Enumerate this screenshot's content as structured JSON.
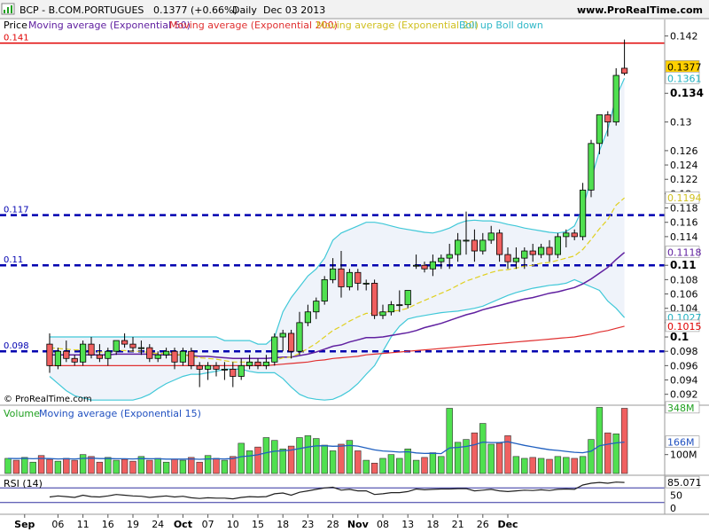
{
  "header": {
    "symbol": "BCP - B.COM.PORTUGUES",
    "last": "0.1377 (+0.66%)",
    "period": "Daily",
    "date": "Dec 03 2013",
    "site": "www.ProRealTime.com"
  },
  "legend": {
    "price": "Price",
    "ema50": "Moving average (Exponential 50)",
    "ema200": "Moving average (Exponential 200)",
    "ema20": "Moving average (Exponential 20)",
    "boll": "Boll up Boll down"
  },
  "watermark": "© ProRealTime.com",
  "volume_legend": {
    "title": "Volume",
    "ma": "Moving average (Exponential 15)"
  },
  "rsi_legend": "RSI (14)",
  "levels": [
    {
      "value": 0.141,
      "label": "0.141",
      "color": "#e00000",
      "style": "solid"
    },
    {
      "value": 0.117,
      "label": "0.117",
      "color": "#0000b0",
      "style": "dashed"
    },
    {
      "value": 0.11,
      "label": "0.11",
      "color": "#0000b0",
      "style": "dashed"
    },
    {
      "value": 0.098,
      "label": "0.098",
      "color": "#0000b0",
      "style": "dashed"
    }
  ],
  "price_badges": [
    {
      "value": 0.1377,
      "label": "0.1377",
      "bg": "#ffd000",
      "fg": "#000000"
    },
    {
      "value": 0.1361,
      "label": "0.1361",
      "bg": "#ffffff",
      "fg": "#20b0c0"
    },
    {
      "value": 0.1194,
      "label": "0.1194",
      "bg": "#ffffff",
      "fg": "#d0c020"
    },
    {
      "value": 0.1118,
      "label": "0.1118",
      "bg": "#ffffff",
      "fg": "#6020a0"
    },
    {
      "value": 0.1027,
      "label": "0.1027",
      "bg": "#ffffff",
      "fg": "#20b0c0"
    },
    {
      "value": 0.1015,
      "label": "0.1015",
      "bg": "#ffffff",
      "fg": "#e00000"
    }
  ],
  "volume_badges": [
    {
      "value": 348,
      "label": "348M",
      "bg": "#ffffff",
      "fg": "#20a020"
    },
    {
      "value": 166,
      "label": "166M",
      "bg": "#ffffff",
      "fg": "#2050c0"
    }
  ],
  "rsi_badge": {
    "label": "85.071"
  },
  "colors": {
    "up": "#50e050",
    "down": "#f06060",
    "bb": "#40c8d8",
    "ema20": "#e0d020",
    "ema50": "#6020a0",
    "ema200": "#e03030",
    "vol_ma": "#2060c0",
    "rsi": "#202020",
    "level": "#0000b0"
  },
  "chart_data": {
    "type": "candlestick",
    "price_axis": {
      "ticks": [
        0.142,
        0.134,
        0.13,
        0.126,
        0.124,
        0.122,
        0.12,
        0.118,
        0.116,
        0.114,
        0.11,
        0.108,
        0.106,
        0.104,
        0.102,
        0.1,
        0.098,
        0.096,
        0.094,
        0.092
      ],
      "bold": [
        0.134,
        0.11,
        0.1
      ],
      "range": [
        0.0906,
        0.1443
      ]
    },
    "volume_axis": {
      "ticks": [
        {
          "value": 100,
          "label": "100M"
        }
      ],
      "range": [
        0,
        352
      ]
    },
    "rsi_axis": {
      "ticks": [
        50,
        0
      ],
      "range": [
        0,
        100
      ],
      "lines": [
        70,
        30
      ]
    },
    "x_labels": [
      "Sep",
      "06",
      "11",
      "16",
      "19",
      "24",
      "Oct",
      "07",
      "10",
      "15",
      "18",
      "23",
      "28",
      "Nov",
      "08",
      "13",
      "18",
      "21",
      "26",
      "Dec"
    ],
    "x_label_index": [
      2,
      6,
      9,
      12,
      15,
      18,
      21,
      24,
      27,
      30,
      33,
      36,
      39,
      42,
      45,
      48,
      51,
      54,
      57,
      60
    ],
    "candles": [
      [
        0.099,
        0.1005,
        0.095,
        0.096
      ],
      [
        0.096,
        0.0985,
        0.0955,
        0.098
      ],
      [
        0.098,
        0.0995,
        0.0965,
        0.097
      ],
      [
        0.097,
        0.0975,
        0.096,
        0.0965
      ],
      [
        0.0965,
        0.0995,
        0.096,
        0.099
      ],
      [
        0.099,
        0.1,
        0.097,
        0.0975
      ],
      [
        0.0975,
        0.099,
        0.0965,
        0.097
      ],
      [
        0.097,
        0.0985,
        0.096,
        0.098
      ],
      [
        0.098,
        0.0995,
        0.0975,
        0.0995
      ],
      [
        0.0995,
        0.1005,
        0.0985,
        0.099
      ],
      [
        0.099,
        0.1,
        0.098,
        0.0985
      ],
      [
        0.0985,
        0.0995,
        0.0975,
        0.0985
      ],
      [
        0.0985,
        0.099,
        0.0965,
        0.097
      ],
      [
        0.097,
        0.098,
        0.0965,
        0.0975
      ],
      [
        0.0975,
        0.0985,
        0.097,
        0.098
      ],
      [
        0.098,
        0.0985,
        0.0955,
        0.0965
      ],
      [
        0.0965,
        0.0985,
        0.096,
        0.098
      ],
      [
        0.098,
        0.0985,
        0.0955,
        0.096
      ],
      [
        0.096,
        0.0965,
        0.093,
        0.0955
      ],
      [
        0.0955,
        0.0965,
        0.094,
        0.096
      ],
      [
        0.096,
        0.0965,
        0.0945,
        0.0955
      ],
      [
        0.0955,
        0.0965,
        0.094,
        0.0955
      ],
      [
        0.0955,
        0.0965,
        0.093,
        0.0945
      ],
      [
        0.0945,
        0.097,
        0.094,
        0.096
      ],
      [
        0.096,
        0.0975,
        0.0955,
        0.0965
      ],
      [
        0.0965,
        0.097,
        0.0955,
        0.096
      ],
      [
        0.096,
        0.0975,
        0.0955,
        0.0965
      ],
      [
        0.0965,
        0.1005,
        0.096,
        0.1
      ],
      [
        0.1,
        0.101,
        0.098,
        0.1005
      ],
      [
        0.1005,
        0.101,
        0.097,
        0.098
      ],
      [
        0.098,
        0.1035,
        0.0975,
        0.102
      ],
      [
        0.102,
        0.1045,
        0.1015,
        0.1035
      ],
      [
        0.1035,
        0.1055,
        0.1025,
        0.105
      ],
      [
        0.105,
        0.1085,
        0.1045,
        0.108
      ],
      [
        0.108,
        0.111,
        0.1075,
        0.1095
      ],
      [
        0.1095,
        0.112,
        0.1055,
        0.107
      ],
      [
        0.107,
        0.1095,
        0.1065,
        0.109
      ],
      [
        0.109,
        0.1095,
        0.1065,
        0.1075
      ],
      [
        0.1075,
        0.108,
        0.1065,
        0.1075
      ],
      [
        0.1075,
        0.108,
        0.1025,
        0.103
      ],
      [
        0.103,
        0.1045,
        0.1025,
        0.1035
      ],
      [
        0.1035,
        0.105,
        0.103,
        0.1045
      ],
      [
        0.1045,
        0.1065,
        0.1035,
        0.1045
      ],
      [
        0.1045,
        0.1065,
        0.104,
        0.1065
      ],
      [
        0.11,
        0.1115,
        0.1095,
        0.11
      ],
      [
        0.11,
        0.1105,
        0.109,
        0.1095
      ],
      [
        0.1095,
        0.1115,
        0.1085,
        0.1105
      ],
      [
        0.1105,
        0.1115,
        0.1095,
        0.111
      ],
      [
        0.111,
        0.113,
        0.1095,
        0.1115
      ],
      [
        0.1115,
        0.1145,
        0.1105,
        0.1135
      ],
      [
        0.1135,
        0.1175,
        0.1115,
        0.1135
      ],
      [
        0.1135,
        0.115,
        0.1105,
        0.112
      ],
      [
        0.112,
        0.1145,
        0.1115,
        0.1135
      ],
      [
        0.1135,
        0.1155,
        0.113,
        0.1145
      ],
      [
        0.1145,
        0.115,
        0.1105,
        0.1115
      ],
      [
        0.1115,
        0.1125,
        0.1095,
        0.1105
      ],
      [
        0.1105,
        0.1125,
        0.1095,
        0.111
      ],
      [
        0.111,
        0.1125,
        0.1095,
        0.112
      ],
      [
        0.112,
        0.113,
        0.1105,
        0.1115
      ],
      [
        0.1115,
        0.113,
        0.111,
        0.1125
      ],
      [
        0.1125,
        0.1135,
        0.1105,
        0.1115
      ],
      [
        0.1115,
        0.1145,
        0.111,
        0.114
      ],
      [
        0.114,
        0.115,
        0.1125,
        0.1145
      ],
      [
        0.1145,
        0.115,
        0.1135,
        0.114
      ],
      [
        0.114,
        0.1215,
        0.1135,
        0.1205
      ],
      [
        0.1205,
        0.1275,
        0.1195,
        0.127
      ],
      [
        0.127,
        0.131,
        0.1255,
        0.131
      ],
      [
        0.131,
        0.1315,
        0.128,
        0.13
      ],
      [
        0.13,
        0.1375,
        0.1295,
        0.1365
      ],
      [
        0.1375,
        0.1415,
        0.1365,
        0.1368
      ]
    ],
    "volume": [
      80,
      70,
      85,
      60,
      95,
      75,
      65,
      80,
      70,
      100,
      90,
      60,
      85,
      70,
      75,
      65,
      90,
      70,
      80,
      60,
      75,
      70,
      85,
      60,
      95,
      80,
      70,
      90,
      160,
      120,
      140,
      190,
      175,
      130,
      145,
      190,
      200,
      185,
      150,
      120,
      155,
      175,
      120,
      70,
      55,
      80,
      100,
      80,
      130,
      70,
      85,
      110,
      90,
      345,
      165,
      180,
      215,
      265,
      155,
      160,
      200,
      90,
      80,
      85,
      80,
      75,
      90,
      85,
      80,
      90,
      180,
      350,
      215,
      210,
      345
    ],
    "volume_ma": [
      80,
      79,
      80,
      78,
      80,
      79,
      77,
      78,
      77,
      80,
      81,
      79,
      79,
      78,
      78,
      77,
      79,
      78,
      78,
      76,
      76,
      76,
      77,
      75,
      77,
      78,
      77,
      79,
      89,
      93,
      99,
      110,
      118,
      120,
      124,
      132,
      140,
      146,
      147,
      144,
      145,
      149,
      145,
      135,
      125,
      119,
      117,
      113,
      115,
      109,
      106,
      107,
      105,
      135,
      138,
      143,
      152,
      166,
      164,
      164,
      168,
      158,
      149,
      141,
      133,
      126,
      122,
      117,
      112,
      110,
      118,
      147,
      155,
      162,
      166
    ],
    "rsi": [
      45,
      48,
      46,
      44,
      50,
      46,
      45,
      48,
      52,
      50,
      48,
      47,
      44,
      46,
      48,
      45,
      47,
      43,
      41,
      43,
      42,
      42,
      40,
      44,
      46,
      45,
      46,
      54,
      56,
      50,
      58,
      62,
      66,
      70,
      72,
      64,
      66,
      62,
      62,
      52,
      54,
      57,
      57,
      60,
      67,
      65,
      66,
      67,
      67,
      68,
      68,
      62,
      64,
      66,
      62,
      60,
      62,
      64,
      63,
      65,
      63,
      66,
      67,
      66,
      78,
      83,
      85,
      83,
      86,
      85.1
    ],
    "ema20": [
      0.0985,
      0.0984,
      0.0983,
      0.0982,
      0.0982,
      0.0981,
      0.0979,
      0.0979,
      0.0981,
      0.0981,
      0.098,
      0.098,
      0.0978,
      0.0977,
      0.0977,
      0.0975,
      0.0975,
      0.0973,
      0.0971,
      0.097,
      0.0969,
      0.0967,
      0.0965,
      0.0965,
      0.0965,
      0.0964,
      0.0964,
      0.0967,
      0.0971,
      0.0972,
      0.0977,
      0.0984,
      0.0991,
      0.1,
      0.1009,
      0.1015,
      0.1022,
      0.1028,
      0.1033,
      0.1033,
      0.1034,
      0.1036,
      0.1037,
      0.104,
      0.1046,
      0.1051,
      0.1056,
      0.1061,
      0.1066,
      0.1072,
      0.1078,
      0.1082,
      0.1086,
      0.109,
      0.1093,
      0.1094,
      0.1096,
      0.1099,
      0.11,
      0.1103,
      0.1104,
      0.1107,
      0.111,
      0.1113,
      0.1122,
      0.1136,
      0.1151,
      0.1164,
      0.1184,
      0.1194
    ],
    "ema50": [
      0.0975,
      0.0975,
      0.0975,
      0.0975,
      0.0975,
      0.0975,
      0.0975,
      0.0975,
      0.0976,
      0.0976,
      0.0976,
      0.0976,
      0.0976,
      0.0975,
      0.0975,
      0.0975,
      0.0975,
      0.0974,
      0.0973,
      0.0973,
      0.0972,
      0.0971,
      0.097,
      0.097,
      0.097,
      0.097,
      0.097,
      0.0971,
      0.0972,
      0.0972,
      0.0974,
      0.0976,
      0.0979,
      0.0983,
      0.0987,
      0.0989,
      0.0993,
      0.0996,
      0.0999,
      0.0999,
      0.1,
      0.1002,
      0.1004,
      0.1006,
      0.1009,
      0.1013,
      0.1016,
      0.1019,
      0.1023,
      0.1027,
      0.1031,
      0.1034,
      0.1038,
      0.1041,
      0.1044,
      0.1047,
      0.105,
      0.1053,
      0.1055,
      0.1058,
      0.1061,
      0.1063,
      0.1066,
      0.1069,
      0.1074,
      0.1081,
      0.1089,
      0.1097,
      0.1108,
      0.1118
    ],
    "ema200": [
      0.096,
      0.096,
      0.096,
      0.096,
      0.096,
      0.096,
      0.096,
      0.096,
      0.096,
      0.096,
      0.096,
      0.096,
      0.096,
      0.096,
      0.096,
      0.096,
      0.096,
      0.096,
      0.096,
      0.096,
      0.096,
      0.096,
      0.096,
      0.096,
      0.096,
      0.096,
      0.096,
      0.0961,
      0.0962,
      0.0963,
      0.0964,
      0.0965,
      0.0967,
      0.0968,
      0.097,
      0.0971,
      0.0972,
      0.0973,
      0.0975,
      0.0976,
      0.0977,
      0.0978,
      0.0979,
      0.098,
      0.0981,
      0.0982,
      0.0983,
      0.0984,
      0.0985,
      0.0986,
      0.0987,
      0.0988,
      0.0989,
      0.099,
      0.0991,
      0.0992,
      0.0993,
      0.0994,
      0.0995,
      0.0996,
      0.0997,
      0.0998,
      0.0999,
      0.1,
      0.1002,
      0.1004,
      0.1007,
      0.1009,
      0.1012,
      0.1015
    ],
    "bb_up": [
      0.1,
      0.1,
      0.1,
      0.1,
      0.1,
      0.1,
      0.1,
      0.1,
      0.1,
      0.1,
      0.1,
      0.1,
      0.1,
      0.1,
      0.1,
      0.1,
      0.1,
      0.1,
      0.1,
      0.1,
      0.1,
      0.0995,
      0.0995,
      0.0995,
      0.0995,
      0.099,
      0.099,
      0.1,
      0.1035,
      0.1055,
      0.107,
      0.1085,
      0.1095,
      0.111,
      0.1135,
      0.1145,
      0.115,
      0.1155,
      0.116,
      0.116,
      0.1158,
      0.1155,
      0.1152,
      0.115,
      0.1148,
      0.1146,
      0.1145,
      0.1148,
      0.1152,
      0.1158,
      0.1162,
      0.1163,
      0.1162,
      0.1162,
      0.116,
      0.1157,
      0.1155,
      0.1152,
      0.115,
      0.1148,
      0.1146,
      0.1145,
      0.1147,
      0.1155,
      0.118,
      0.122,
      0.126,
      0.129,
      0.1335,
      0.1361
    ],
    "bb_dn": [
      0.0945,
      0.0935,
      0.0925,
      0.0918,
      0.0915,
      0.0912,
      0.0912,
      0.0912,
      0.0912,
      0.0912,
      0.0912,
      0.0915,
      0.092,
      0.0928,
      0.0935,
      0.094,
      0.0945,
      0.0948,
      0.0948,
      0.095,
      0.0952,
      0.0955,
      0.0955,
      0.0955,
      0.0952,
      0.095,
      0.095,
      0.095,
      0.0942,
      0.093,
      0.092,
      0.0915,
      0.0913,
      0.0912,
      0.0913,
      0.0918,
      0.0925,
      0.0935,
      0.0948,
      0.096,
      0.098,
      0.1,
      0.1015,
      0.1025,
      0.1028,
      0.103,
      0.1032,
      0.1034,
      0.1035,
      0.1036,
      0.1038,
      0.104,
      0.1043,
      0.1048,
      0.1053,
      0.1058,
      0.1062,
      0.1065,
      0.1068,
      0.107,
      0.1072,
      0.1073,
      0.1075,
      0.108,
      0.1075,
      0.107,
      0.1065,
      0.105,
      0.104,
      0.1027
    ]
  }
}
